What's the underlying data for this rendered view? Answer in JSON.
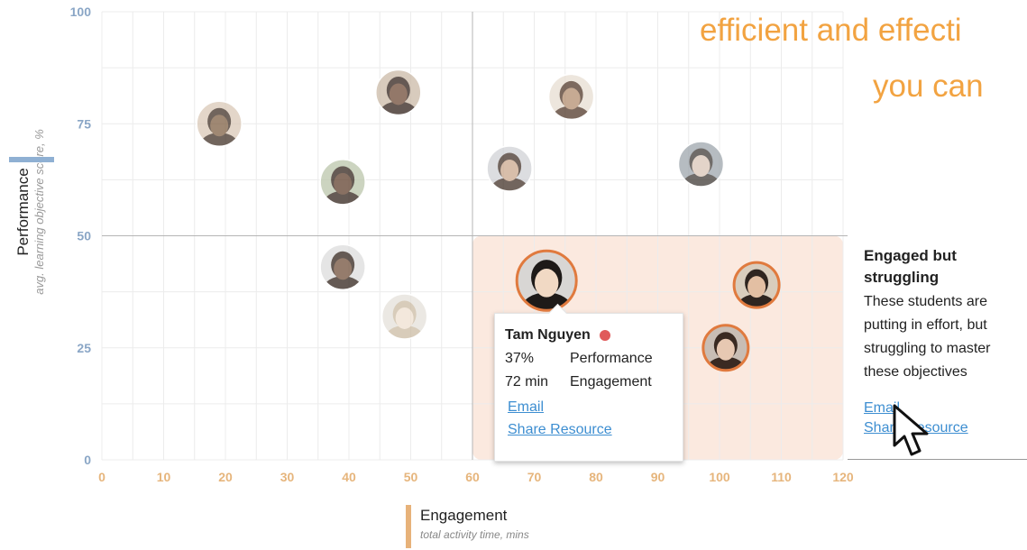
{
  "headline": {
    "line1": "efficient and effecti",
    "line2": "you can"
  },
  "chart_data": {
    "type": "scatter",
    "xlabel": "Engagement",
    "xsublabel": "total activity time, mins",
    "ylabel": "Performance",
    "ysublabel": "avg. learning objective score, %",
    "xlim": [
      0,
      120
    ],
    "ylim": [
      0,
      100
    ],
    "xticks": [
      0,
      10,
      20,
      30,
      40,
      50,
      60,
      70,
      80,
      90,
      100,
      110,
      120
    ],
    "yticks": [
      0,
      25,
      50,
      75,
      100
    ],
    "grid": true,
    "quadrant_lines": {
      "x": 60,
      "y": 50
    },
    "highlight_region": {
      "x": [
        60,
        120
      ],
      "y": [
        0,
        50
      ]
    },
    "points": [
      {
        "x": 19,
        "y": 75,
        "avatar": "student-photo",
        "highlighted": false
      },
      {
        "x": 48,
        "y": 82,
        "avatar": "student-photo",
        "highlighted": false
      },
      {
        "x": 76,
        "y": 81,
        "avatar": "student-photo",
        "highlighted": false
      },
      {
        "x": 39,
        "y": 62,
        "avatar": "student-photo",
        "highlighted": false
      },
      {
        "x": 66,
        "y": 65,
        "avatar": "student-photo",
        "highlighted": false
      },
      {
        "x": 97,
        "y": 66,
        "avatar": "student-photo",
        "highlighted": false
      },
      {
        "x": 39,
        "y": 43,
        "avatar": "student-photo",
        "highlighted": false
      },
      {
        "x": 49,
        "y": 32,
        "avatar": "student-photo",
        "highlighted": false
      },
      {
        "x": 72,
        "y": 40,
        "avatar": "student-photo",
        "highlighted": true,
        "selected": true
      },
      {
        "x": 106,
        "y": 39,
        "avatar": "student-photo",
        "highlighted": true
      },
      {
        "x": 101,
        "y": 25,
        "avatar": "student-photo",
        "highlighted": true
      }
    ]
  },
  "tooltip": {
    "name": "Tam Nguyen",
    "status_color": "#e05a5a",
    "performance_value": "37%",
    "performance_label": "Performance",
    "engagement_value": "72 min",
    "engagement_label": "Engagement",
    "email_link": "Email",
    "share_link": "Share Resource"
  },
  "panel": {
    "title": "Engaged but struggling",
    "description": "These students are putting in effort, but struggling to master these objectives",
    "email_link": "Email",
    "share_link": "Share Resource"
  },
  "colors": {
    "highlight_fill": "#fbe9df",
    "accent_orange": "#e07a3e",
    "y_axis": "#8aa6c6",
    "x_axis": "#e6b57c",
    "headline": "#f2a341",
    "link": "#3d8ed1"
  },
  "icons": {
    "cursor": "pointer-arrow-icon"
  }
}
